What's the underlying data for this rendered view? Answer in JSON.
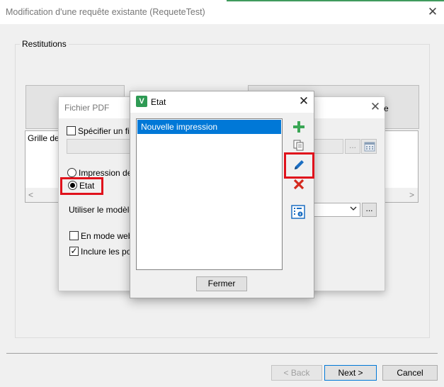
{
  "window": {
    "title": "Modification d'une requête existante (RequeteTest)",
    "close_glyph": "✕"
  },
  "group": {
    "label": "Restitutions"
  },
  "background": {
    "grid_label": "Grille de d",
    "right_panel_fragment": "e",
    "scroll_left": "<",
    "scroll_right": ">"
  },
  "pdf_dialog": {
    "title": "Fichier PDF",
    "close_glyph": "✕",
    "specifier_label": "Spécifier un fich",
    "specifier_checked": false,
    "browse_label": "...",
    "impression_label": "Impression de l",
    "etat_label": "Etat",
    "selected_option": "Etat",
    "modele_label": "Utiliser le modèle d",
    "model_browse_label": "...",
    "web_label": "En mode web,",
    "web_checked": false,
    "polices_label": "Inclure les polic",
    "polices_checked": true,
    "polices_tick": "✓"
  },
  "etat_dialog": {
    "logo": "V",
    "title": "Etat",
    "close_glyph": "✕",
    "items": [
      "Nouvelle impression"
    ],
    "selected_index": 0,
    "side_buttons": [
      "add-icon",
      "copy-icon",
      "edit-icon",
      "delete-icon",
      "config-icon"
    ],
    "close_button_label": "Fermer"
  },
  "footer": {
    "back_label": "< Back",
    "next_label": "Next >",
    "cancel_label": "Cancel"
  },
  "colors": {
    "selection": "#0078d7",
    "highlight": "#e0121c",
    "add_icon": "#3aa655",
    "delete_icon": "#d42a1e",
    "edit_icon": "#1b6ec2",
    "logo": "#2e9a54"
  }
}
